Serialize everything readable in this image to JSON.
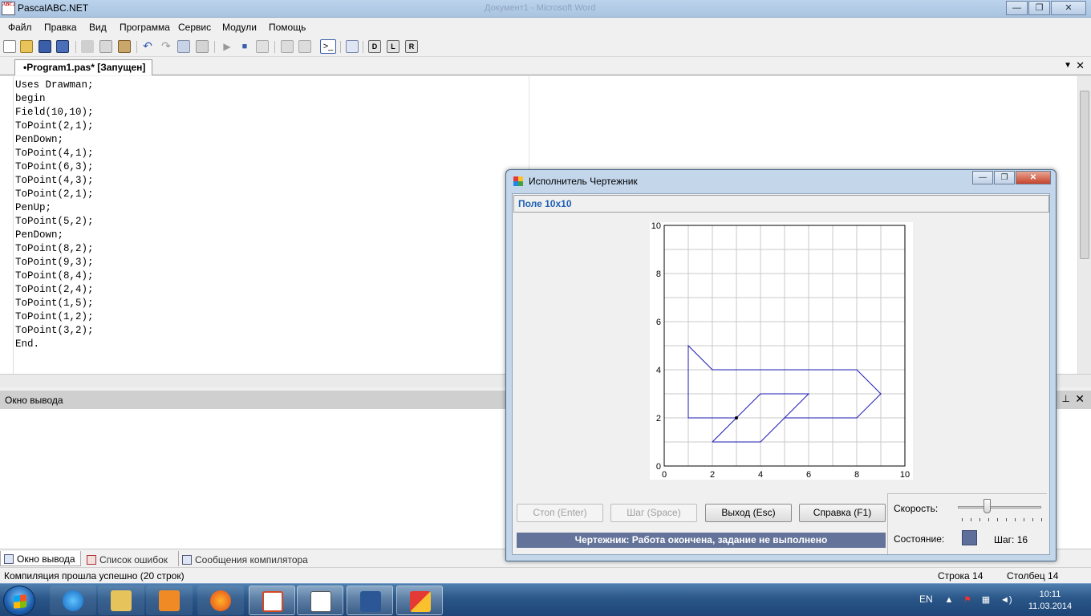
{
  "app": {
    "title": "PascalABC.NET",
    "icon_text": "ABC.net",
    "background_window_title": "Документ1 - Microsoft Word",
    "window_buttons": [
      "—",
      "❐",
      "✕"
    ]
  },
  "menu": [
    "Файл",
    "Правка",
    "Вид",
    "Программа",
    "Сервис",
    "Модули",
    "Помощь"
  ],
  "toolbar_icons": [
    "new-file-icon",
    "open-folder-icon",
    "save-icon",
    "save-all-icon",
    "cut-icon",
    "copy-icon",
    "paste-icon",
    "undo-icon",
    "redo-icon",
    "indent-icon",
    "outdent-icon",
    "run-icon",
    "stop-icon",
    "debug-icon",
    "comment-icon",
    "uncomment-icon",
    "console-icon",
    "format-icon",
    "view-d-icon",
    "view-l-icon",
    "view-r-icon"
  ],
  "editor": {
    "tab_label": "•Program1.pas* [Запущен]",
    "code_lines": [
      "Uses Drawman;",
      "begin",
      "Field(10,10);",
      "ToPoint(2,1);",
      "PenDown;",
      "ToPoint(4,1);",
      "ToPoint(6,3);",
      "ToPoint(4,3);",
      "ToPoint(2,1);",
      "PenUp;",
      "ToPoint(5,2);",
      "PenDown;",
      "ToPoint(8,2);",
      "ToPoint(9,3);",
      "ToPoint(8,4);",
      "ToPoint(2,4);",
      "ToPoint(1,5);",
      "ToPoint(1,2);",
      "ToPoint(3,2);",
      "End."
    ]
  },
  "output": {
    "header": "Окно вывода",
    "tabs": [
      "Окно вывода",
      "Список ошибок",
      "Сообщения компилятора"
    ]
  },
  "status": {
    "message": "Компиляция прошла успешно (20 строк)",
    "row": "Строка  14",
    "col": "Столбец  14"
  },
  "drawman": {
    "title": "Исполнитель Чертежник",
    "field_label": "Поле 10x10",
    "buttons": {
      "stop": "Стоп (Enter)",
      "step": "Шаг (Space)",
      "exit": "Выход (Esc)",
      "help": "Справка (F1)"
    },
    "state_message": "Чертежник: Работа окончена, задание не выполнено",
    "speed_label": "Скорость:",
    "state_label": "Состояние:",
    "step_label": "Шаг: 16",
    "speed_level": 0.35,
    "colors": {
      "line": "#1a1ab0",
      "grid": "#c8c8c8",
      "state_bar": "#647399"
    }
  },
  "chart_data": {
    "type": "line",
    "xlim": [
      0,
      10
    ],
    "ylim": [
      0,
      10
    ],
    "xticks": [
      "0",
      "2",
      "4",
      "6",
      "8",
      "10"
    ],
    "yticks": [
      "0",
      "2",
      "4",
      "6",
      "8",
      "10"
    ],
    "grid": true,
    "series": [
      {
        "points": [
          [
            2,
            1
          ],
          [
            4,
            1
          ],
          [
            6,
            3
          ],
          [
            4,
            3
          ],
          [
            2,
            1
          ]
        ]
      },
      {
        "points": [
          [
            5,
            2
          ],
          [
            8,
            2
          ],
          [
            9,
            3
          ],
          [
            8,
            4
          ],
          [
            2,
            4
          ],
          [
            1,
            5
          ],
          [
            1,
            2
          ],
          [
            3,
            2
          ]
        ]
      }
    ],
    "current_point": [
      3,
      2
    ]
  },
  "taskbar": {
    "apps": [
      "explorer",
      "internet-explorer",
      "media-player",
      "firefox",
      "powerpoint",
      "pascalabc",
      "word",
      "drawman"
    ],
    "language": "EN",
    "time": "10:11",
    "date": "11.03.2014"
  }
}
